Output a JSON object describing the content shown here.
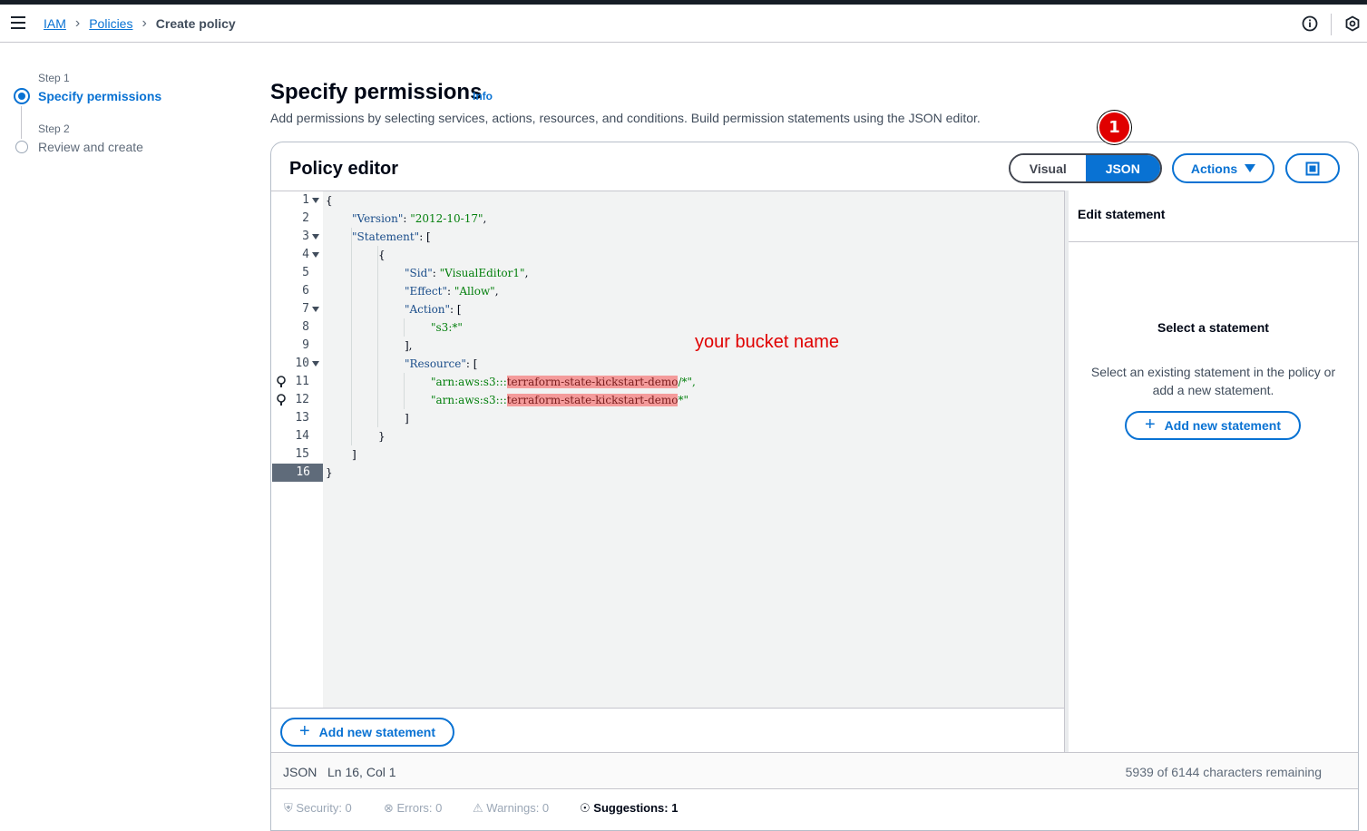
{
  "breadcrumb": {
    "items": [
      {
        "label": "IAM"
      },
      {
        "label": "Policies"
      }
    ],
    "current": "Create policy"
  },
  "steps": [
    {
      "small": "Step 1",
      "label": "Specify permissions"
    },
    {
      "small": "Step 2",
      "label": "Review and create"
    }
  ],
  "page": {
    "title": "Specify permissions",
    "info": "Info",
    "description": "Add permissions by selecting services, actions, resources, and conditions. Build permission statements using the JSON editor."
  },
  "editor": {
    "title": "Policy editor",
    "mode_visual": "Visual",
    "mode_json": "JSON",
    "actions_label": "Actions",
    "annotation_badge": "1",
    "annotation_text": "your bucket name",
    "line_numbers": [
      "1",
      "2",
      "3",
      "4",
      "5",
      "6",
      "7",
      "8",
      "9",
      "10",
      "11",
      "12",
      "13",
      "14",
      "15",
      "16"
    ],
    "code": {
      "l1": "{",
      "l2_key": "\"Version\"",
      "l2_val": "\"2012-10-17\"",
      "l3_key": "\"Statement\"",
      "l4": "{",
      "l5_key": "\"Sid\"",
      "l5_val": "\"VisualEditor1\"",
      "l6_key": "\"Effect\"",
      "l6_val": "\"Allow\"",
      "l7_key": "\"Action\"",
      "l8_val": "\"s3:*\"",
      "l9": "],",
      "l10_key": "\"Resource\"",
      "l11_pre": "\"arn:aws:s3:::",
      "l11_bucket": "terraform-state-kickstart-demo",
      "l11_post": "/*\",",
      "l12_pre": "\"arn:aws:s3:::",
      "l12_bucket": "terraform-state-kickstart-demo",
      "l12_post": "*\"",
      "l13": "]",
      "l14": "}",
      "l15": "]",
      "l16": "}"
    },
    "add_statement": "Add new statement"
  },
  "side_panel": {
    "header": "Edit statement",
    "title": "Select a statement",
    "description": "Select an existing statement in the policy or add a new statement.",
    "add_statement": "Add new statement"
  },
  "status": {
    "mode": "JSON",
    "position": "Ln 16, Col 1",
    "remaining": "5939 of 6144 characters remaining"
  },
  "bottom_tabs": {
    "security": "Security: 0",
    "errors": "Errors: 0",
    "warnings": "Warnings: 0",
    "suggestions": "Suggestions: 1"
  },
  "colors": {
    "accent": "#0972d3",
    "highlight": "#f49b9b",
    "annotation": "#e00000"
  }
}
